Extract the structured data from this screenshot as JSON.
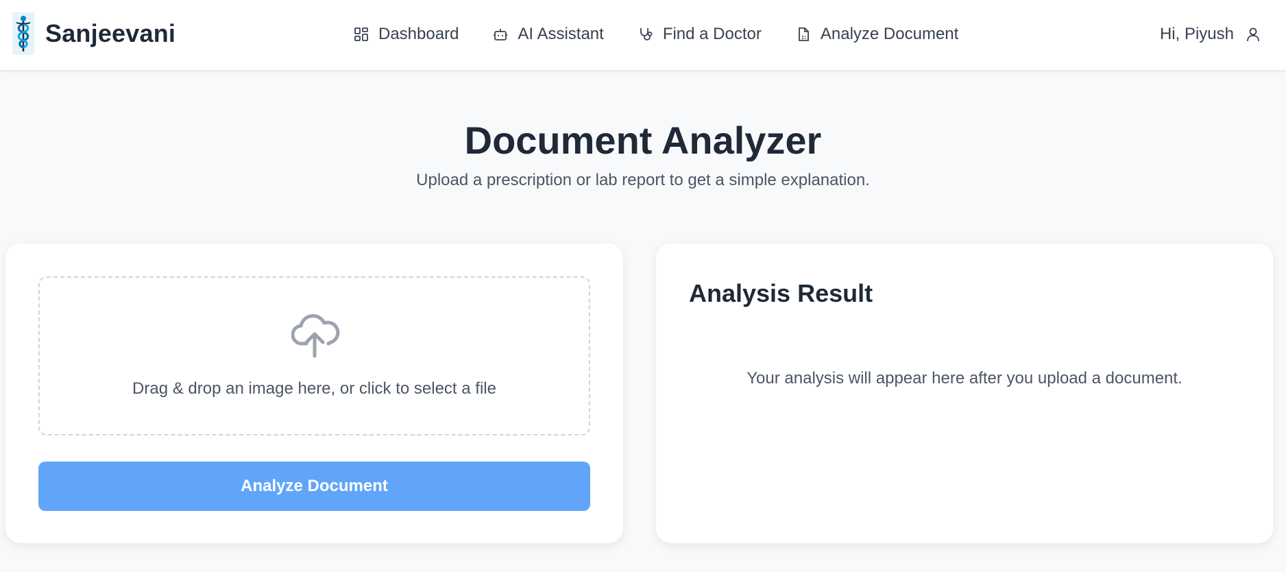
{
  "brand": {
    "name": "Sanjeevani",
    "logo_icon": "caduceus-icon"
  },
  "nav": {
    "items": [
      {
        "label": "Dashboard",
        "icon": "grid-icon"
      },
      {
        "label": "AI Assistant",
        "icon": "robot-icon"
      },
      {
        "label": "Find a Doctor",
        "icon": "stethoscope-icon"
      },
      {
        "label": "Analyze Document",
        "icon": "document-icon"
      }
    ]
  },
  "user": {
    "greeting": "Hi, Piyush",
    "icon": "user-icon"
  },
  "page": {
    "title": "Document Analyzer",
    "subtitle": "Upload a prescription or lab report to get a simple explanation."
  },
  "upload": {
    "icon": "cloud-upload-icon",
    "dropzone_text": "Drag & drop an image here, or click to select a file",
    "button_label": "Analyze Document"
  },
  "result": {
    "title": "Analysis Result",
    "placeholder": "Your analysis will appear here after you upload a document."
  },
  "colors": {
    "accent_button": "#60a5fa",
    "page_background": "#f8f9fb",
    "text_primary": "#1f2937",
    "logo_blue": "#0284c7"
  }
}
